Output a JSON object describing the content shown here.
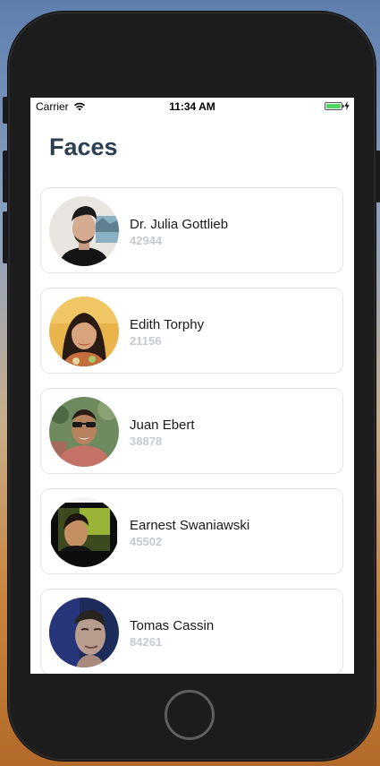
{
  "status_bar": {
    "carrier": "Carrier",
    "time": "11:34 AM",
    "wifi_icon": "wifi-icon",
    "battery_icon": "battery-icon",
    "charging_icon": "bolt-icon",
    "battery_color": "#4cd964"
  },
  "page": {
    "title": "Faces",
    "title_color": "#2c3e50"
  },
  "faces": [
    {
      "name": "Dr. Julia Gottlieb",
      "number": "42944"
    },
    {
      "name": "Edith Torphy",
      "number": "21156"
    },
    {
      "name": "Juan Ebert",
      "number": "38878"
    },
    {
      "name": "Earnest Swaniawski",
      "number": "45502"
    },
    {
      "name": "Tomas Cassin",
      "number": "84261"
    }
  ],
  "colors": {
    "number_text": "#c5cad1",
    "card_border": "#e3e3e3"
  }
}
